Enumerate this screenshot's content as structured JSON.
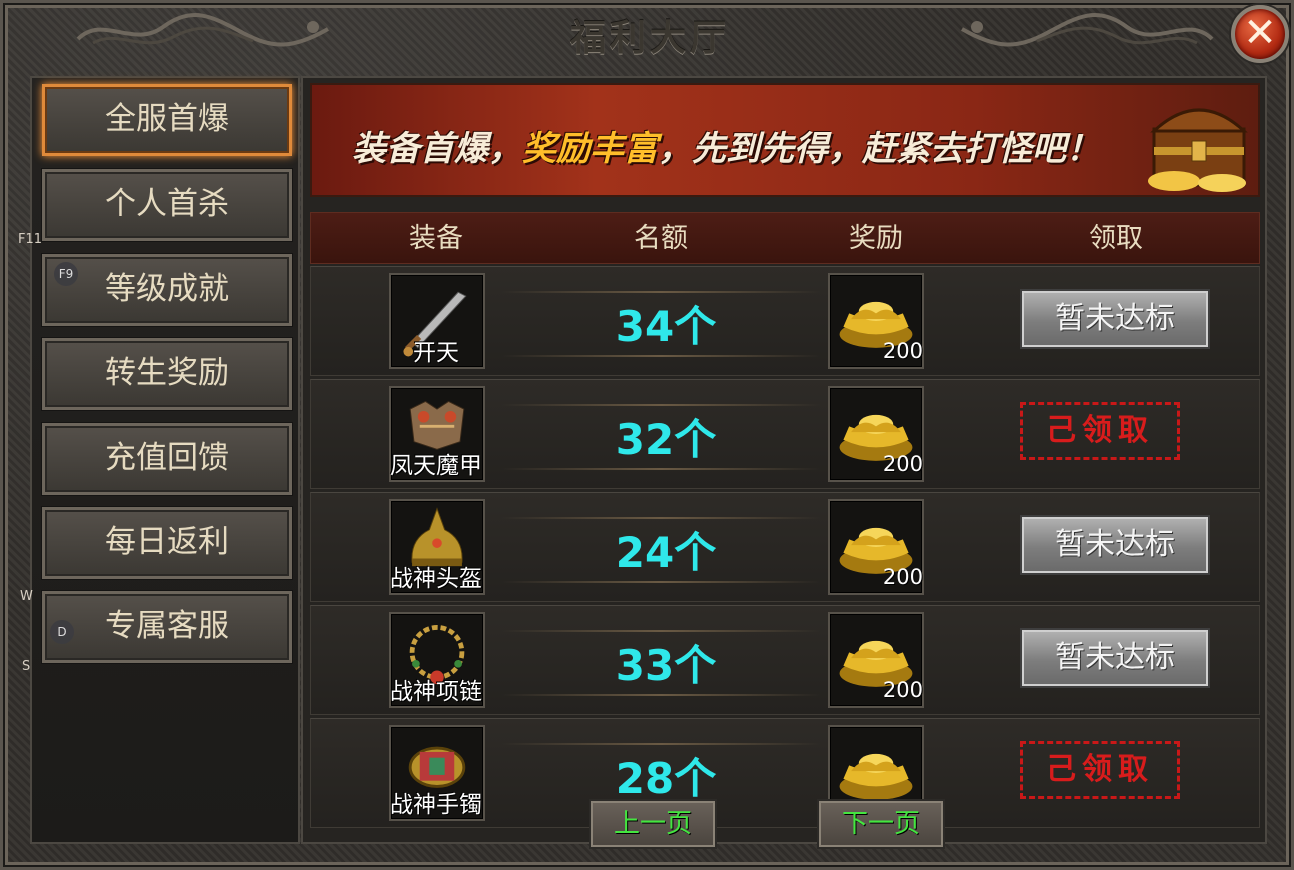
{
  "window": {
    "title": "福利大厅",
    "close_icon": "close-x-icon"
  },
  "hotkeys": {
    "f11": "F11",
    "f9": "F9",
    "w": "W",
    "d": "D",
    "s": "S"
  },
  "nav": {
    "items": [
      {
        "label": "全服首爆",
        "active": true
      },
      {
        "label": "个人首杀",
        "active": false
      },
      {
        "label": "等级成就",
        "active": false
      },
      {
        "label": "转生奖励",
        "active": false
      },
      {
        "label": "充值回馈",
        "active": false
      },
      {
        "label": "每日返利",
        "active": false
      },
      {
        "label": "专属客服",
        "active": false
      }
    ]
  },
  "banner": {
    "part1": "装备首爆，",
    "highlight": "奖励丰富",
    "part2": "，先到先得，赶紧去打怪吧！"
  },
  "table": {
    "headers": {
      "equipment": "装备",
      "quota": "名额",
      "reward": "奖励",
      "claim": "领取"
    },
    "rows": [
      {
        "item": "开天",
        "icon": "sword-icon",
        "quota": "34个",
        "reward_icon": "gold-ingot-icon",
        "reward": "200",
        "status": "暂未达标",
        "claimed": false
      },
      {
        "item": "凤天魔甲",
        "icon": "armor-icon",
        "quota": "32个",
        "reward_icon": "gold-ingot-icon",
        "reward": "200",
        "status": "己领取",
        "claimed": true
      },
      {
        "item": "战神头盔",
        "icon": "helmet-icon",
        "quota": "24个",
        "reward_icon": "gold-ingot-icon",
        "reward": "200",
        "status": "暂未达标",
        "claimed": false
      },
      {
        "item": "战神项链",
        "icon": "necklace-icon",
        "quota": "33个",
        "reward_icon": "gold-ingot-icon",
        "reward": "200",
        "status": "暂未达标",
        "claimed": false
      },
      {
        "item": "战神手镯",
        "icon": "bracelet-icon",
        "quota": "28个",
        "reward_icon": "gold-ingot-icon",
        "reward": "",
        "status": "己领取",
        "claimed": true
      }
    ]
  },
  "pagination": {
    "prev": "上一页",
    "next": "下一页"
  },
  "colors": {
    "quota_text": "#2fe8ea",
    "stamp_red": "#d81c1c",
    "page_btn_text": "#44e640",
    "active_nav_border": "#e08a3a"
  }
}
